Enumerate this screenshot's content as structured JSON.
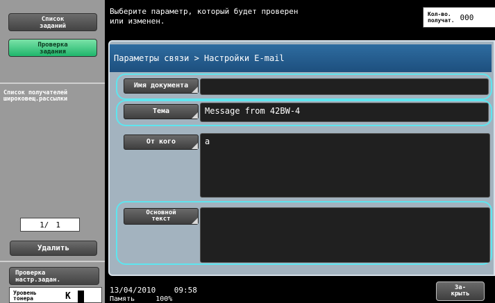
{
  "left_panel": {
    "job_list_button": "Список\nзаданий",
    "check_job_button": "Проверка\nзадания",
    "recipient_list_label": "Список получателей\nшироковещ.рассылки",
    "pager": {
      "current": "1/",
      "total": "1"
    },
    "delete_button": "Удалить",
    "check_settings_button": "Проверка\nнастр.задан.",
    "toner_label": "Уровень\nтонера",
    "toner_color": "K"
  },
  "header": {
    "message": "Выберите параметр, который будет проверен\nили изменен.",
    "count_label": "Кол-во.\nполучат.",
    "count_value": "000"
  },
  "breadcrumb": "Параметры связи > Настройки E-mail",
  "fields": {
    "doc_name": {
      "label": "Имя документа",
      "value": ""
    },
    "subject": {
      "label": "Тема",
      "value": "Message from 42BW-4"
    },
    "from": {
      "label": "От кого",
      "value": "a"
    },
    "body": {
      "label": "Основной\nтекст",
      "value": ""
    }
  },
  "footer": {
    "date": "13/04/2010",
    "time": "09:58",
    "memory_label": "Память",
    "memory_value": "100%",
    "close_button": "За-\nкрыть"
  },
  "colors": {
    "highlight": "#5ee5ef",
    "breadcrumb_bg": "#2e6ca0",
    "active_tab": "#1fb56b"
  }
}
